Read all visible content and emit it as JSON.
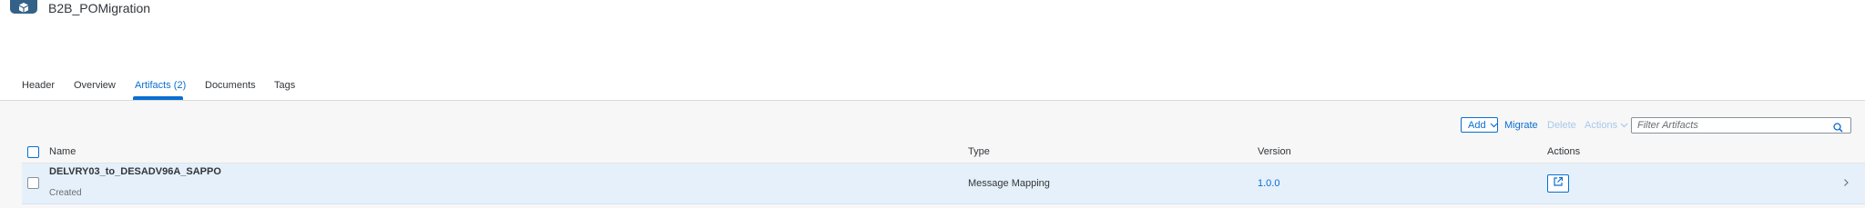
{
  "app": {
    "icon": "package-icon",
    "title": "B2B_POMigration"
  },
  "tabs": [
    {
      "label": "Header",
      "selected": false
    },
    {
      "label": "Overview",
      "selected": false
    },
    {
      "label": "Artifacts (2)",
      "selected": true
    },
    {
      "label": "Documents",
      "selected": false
    },
    {
      "label": "Tags",
      "selected": false
    }
  ],
  "toolbar": {
    "add_label": "Add",
    "migrate_label": "Migrate",
    "delete_label": "Delete",
    "actions_label": "Actions",
    "filter_placeholder": "Filter Artifacts",
    "filter_value": ""
  },
  "table": {
    "columns": [
      "Name",
      "Type",
      "Version",
      "Actions"
    ],
    "rows": [
      {
        "name": "DELVRY03_to_DESADV96A_SAPPO",
        "status": "Created",
        "type": "Message Mapping",
        "version": "1.0.0",
        "action_icon": "open-external-icon",
        "nav_icon": "chevron-right-icon"
      }
    ]
  },
  "colors": {
    "accent": "#0a6ed1",
    "app_icon_bg": "#346187",
    "selected_row_bg": "#e5f0fa",
    "disabled_text": "#a8c8ea",
    "content_bg": "#f7f7f7"
  }
}
